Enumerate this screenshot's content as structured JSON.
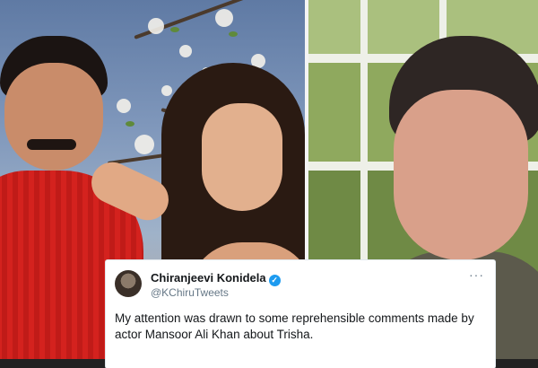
{
  "tweet": {
    "author_name": "Chiranjeevi Konidela",
    "verified_glyph": "✓",
    "handle": "@KChiruTweets",
    "more_glyph": "···",
    "text": "My attention was drawn to some reprehensible comments made by actor Mansoor Ali Khan about Trisha."
  },
  "icons": {
    "verified": "verified-badge-icon",
    "more": "more-options-icon"
  },
  "colors": {
    "verified_blue": "#1d9bf0",
    "text_primary": "#14171a",
    "text_secondary": "#657786",
    "card_bg": "#ffffff"
  }
}
